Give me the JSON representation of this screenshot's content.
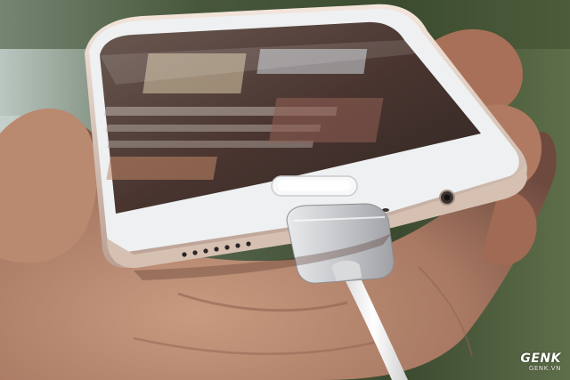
{
  "photo": {
    "subject": "smartphone-with-magnetic-charging-cable",
    "colors": {
      "background_green": "#3a4a2e",
      "skin": "#c79a7e",
      "phone_white": "#eef0f1",
      "phone_frame": "#d8c3b4",
      "screen": "#4d3a33",
      "cable_connector": "#c8c9cc",
      "cable": "#f3f3f3"
    }
  },
  "watermark": {
    "brand": "GENK",
    "site": "GENK.VN"
  }
}
